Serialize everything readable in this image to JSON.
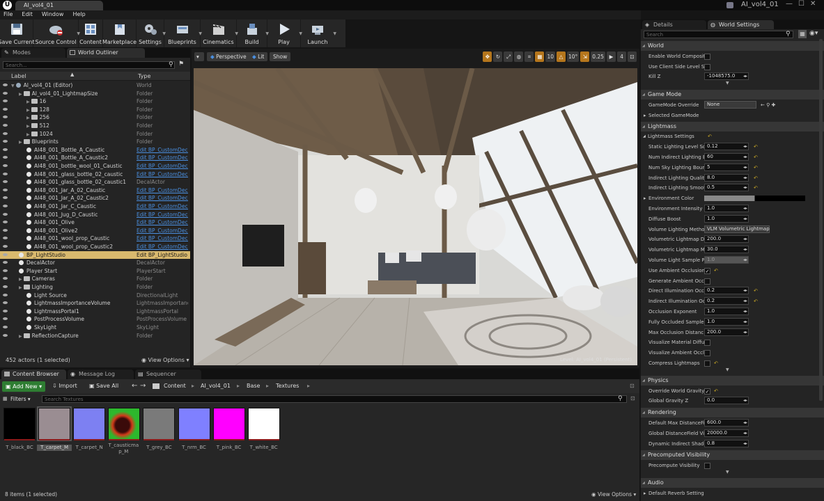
{
  "window": {
    "doc_tab": "AI_vol4_01",
    "project_name": "AI_vol4_01",
    "app_icon": "U"
  },
  "menu": [
    "File",
    "Edit",
    "Window",
    "Help"
  ],
  "toolbar": [
    {
      "label": "Save Current",
      "icon": "save-icon"
    },
    {
      "label": "Source Control",
      "icon": "source-control-icon"
    },
    {
      "label": "Content",
      "icon": "content-icon"
    },
    {
      "label": "Marketplace",
      "icon": "marketplace-icon"
    },
    {
      "label": "Settings",
      "icon": "settings-icon"
    },
    {
      "label": "Blueprints",
      "icon": "blueprints-icon"
    },
    {
      "label": "Cinematics",
      "icon": "cinematics-icon"
    },
    {
      "label": "Build",
      "icon": "build-icon"
    },
    {
      "label": "Play",
      "icon": "play-icon"
    },
    {
      "label": "Launch",
      "icon": "launch-icon"
    }
  ],
  "left_tabs": {
    "modes": "Modes",
    "outliner": "World Outliner"
  },
  "outliner": {
    "search_placeholder": "Search...",
    "col_label": "Label",
    "col_type": "Type",
    "rows": [
      {
        "label": "AI_vol4_01 (Editor)",
        "type": "World",
        "indent": 0,
        "icon": "world",
        "link": false
      },
      {
        "label": "AI_vol4_01_LightmapSize",
        "type": "Folder",
        "indent": 1,
        "icon": "folder",
        "link": false
      },
      {
        "label": "16",
        "type": "Folder",
        "indent": 2,
        "icon": "folder",
        "link": false
      },
      {
        "label": "128",
        "type": "Folder",
        "indent": 2,
        "icon": "folder",
        "link": false
      },
      {
        "label": "256",
        "type": "Folder",
        "indent": 2,
        "icon": "folder",
        "link": false
      },
      {
        "label": "512",
        "type": "Folder",
        "indent": 2,
        "icon": "folder",
        "link": false
      },
      {
        "label": "1024",
        "type": "Folder",
        "indent": 2,
        "icon": "folder",
        "link": false
      },
      {
        "label": "Blueprints",
        "type": "Folder",
        "indent": 1,
        "icon": "folder",
        "link": false
      },
      {
        "label": "AI48_001_Bottle_A_Caustic",
        "type": "Edit BP_CustomDeca",
        "indent": 2,
        "icon": "ball",
        "link": true
      },
      {
        "label": "AI48_001_Bottle_A_Caustic2",
        "type": "Edit BP_CustomDeca",
        "indent": 2,
        "icon": "ball",
        "link": true
      },
      {
        "label": "AI48_001_bottle_wool_01_Caustic",
        "type": "Edit BP_CustomDeca",
        "indent": 2,
        "icon": "ball",
        "link": true
      },
      {
        "label": "AI48_001_glass_bottle_02_caustic",
        "type": "Edit BP_CustomDeca",
        "indent": 2,
        "icon": "ball",
        "link": true
      },
      {
        "label": "AI48_001_glass_bottle_02_caustic1",
        "type": "DecalActor",
        "indent": 2,
        "icon": "ball",
        "link": false
      },
      {
        "label": "AI48_001_Jar_A_02_Caustic",
        "type": "Edit BP_CustomDeca",
        "indent": 2,
        "icon": "ball",
        "link": true
      },
      {
        "label": "AI48_001_Jar_A_02_Caustic2",
        "type": "Edit BP_CustomDeca",
        "indent": 2,
        "icon": "ball",
        "link": true
      },
      {
        "label": "AI48_001_Jar_C_Caustic",
        "type": "Edit BP_CustomDeca",
        "indent": 2,
        "icon": "ball",
        "link": true
      },
      {
        "label": "AI48_001_Jug_D_Caustic",
        "type": "Edit BP_CustomDeca",
        "indent": 2,
        "icon": "ball",
        "link": true
      },
      {
        "label": "AI48_001_Olive",
        "type": "Edit BP_CustomDeca",
        "indent": 2,
        "icon": "ball",
        "link": true
      },
      {
        "label": "AI48_001_Olive2",
        "type": "Edit BP_CustomDeca",
        "indent": 2,
        "icon": "ball",
        "link": true
      },
      {
        "label": "AI48_001_wool_prop_Caustic",
        "type": "Edit BP_CustomDeca",
        "indent": 2,
        "icon": "ball",
        "link": true
      },
      {
        "label": "AI48_001_wool_prop_Caustic2",
        "type": "Edit BP_CustomDeca",
        "indent": 2,
        "icon": "ball",
        "link": true
      },
      {
        "label": "BP_LightStudio",
        "type": "Edit BP_LightStudio",
        "indent": 1,
        "icon": "ball",
        "link": false,
        "selected": true
      },
      {
        "label": "DecalActor",
        "type": "DecalActor",
        "indent": 1,
        "icon": "ball",
        "link": false
      },
      {
        "label": "Player Start",
        "type": "PlayerStart",
        "indent": 1,
        "icon": "ball",
        "link": false
      },
      {
        "label": "Cameras",
        "type": "Folder",
        "indent": 1,
        "icon": "folder",
        "link": false
      },
      {
        "label": "Lighting",
        "type": "Folder",
        "indent": 1,
        "icon": "folder",
        "link": false
      },
      {
        "label": "Light Source",
        "type": "DirectionalLight",
        "indent": 2,
        "icon": "ball",
        "link": false
      },
      {
        "label": "LightmassImportanceVolume",
        "type": "LightmassImportance",
        "indent": 2,
        "icon": "ball",
        "link": false
      },
      {
        "label": "LightmassPortal1",
        "type": "LightmassPortal",
        "indent": 2,
        "icon": "ball",
        "link": false
      },
      {
        "label": "PostProcessVolume",
        "type": "PostProcessVolume",
        "indent": 2,
        "icon": "ball",
        "link": false
      },
      {
        "label": "SkyLight",
        "type": "SkyLight",
        "indent": 2,
        "icon": "ball",
        "link": false
      },
      {
        "label": "ReflectionCapture",
        "type": "Folder",
        "indent": 1,
        "icon": "folder",
        "link": false
      }
    ],
    "footer_count": "452 actors (1 selected)",
    "view_options": "View Options"
  },
  "viewport": {
    "perspective": "Perspective",
    "lit": "Lit",
    "show": "Show",
    "grid_snap": "10",
    "rot_snap": "10°",
    "scale_snap": "0.25",
    "cam_speed": "4",
    "level_label": "Level:  AI_vol4_01 (Persistent)"
  },
  "content_browser": {
    "tabs": [
      "Content Browser",
      "Message Log",
      "Sequencer"
    ],
    "add_new": "Add New",
    "import": "Import",
    "save_all": "Save All",
    "path": [
      "Content",
      "AI_vol4_01",
      "Base",
      "Textures"
    ],
    "filters": "Filters",
    "search_placeholder": "Search Textures",
    "items": [
      {
        "name": "T_black_BC",
        "color": "#000000"
      },
      {
        "name": "T_carpet_M",
        "color": "#9a8d92"
      },
      {
        "name": "T_carpet_N",
        "color": "#7d80f2"
      },
      {
        "name": "T_causticmap_M",
        "color": "#2db82d"
      },
      {
        "name": "T_grey_BC",
        "color": "#7a7a7a"
      },
      {
        "name": "T_nrm_BC",
        "color": "#7f80ff"
      },
      {
        "name": "T_pink_BC",
        "color": "#ff00ff"
      },
      {
        "name": "T_white_BC",
        "color": "#ffffff"
      }
    ],
    "footer_count": "8 items (1 selected)",
    "view_options": "View Options"
  },
  "details": {
    "tabs": [
      "Details",
      "World Settings"
    ],
    "search_placeholder": "Search",
    "sections": {
      "world": "World",
      "game_mode": "Game Mode",
      "lightmass": "Lightmass",
      "physics": "Physics",
      "rendering": "Rendering",
      "precomputed": "Precomputed Visibility",
      "audio": "Audio"
    },
    "world_rows": [
      {
        "label": "Enable World Compositio",
        "kind": "check",
        "value": ""
      },
      {
        "label": "Use Client Side Level Stre",
        "kind": "check",
        "value": ""
      },
      {
        "label": "Kill Z",
        "kind": "num",
        "value": "-1048575.0"
      }
    ],
    "gamemode_rows": [
      {
        "label": "GameMode Override",
        "kind": "dropdown",
        "value": "None"
      },
      {
        "label": "Selected GameMode",
        "kind": "sub",
        "value": ""
      }
    ],
    "lightmass_settings": "Lightmass Settings",
    "lightmass_rows": [
      {
        "label": "Static Lighting Level Sc",
        "kind": "num",
        "value": "0.12",
        "reset": true
      },
      {
        "label": "Num Indirect Lighting B",
        "kind": "num",
        "value": "60",
        "reset": true
      },
      {
        "label": "Num Sky Lighting Boun",
        "kind": "num",
        "value": "5",
        "reset": true
      },
      {
        "label": "Indirect Lighting Qualit",
        "kind": "num",
        "value": "8.0",
        "reset": true
      },
      {
        "label": "Indirect Lighting Smoot",
        "kind": "num",
        "value": "0.5",
        "reset": true
      },
      {
        "label": "Environment Color",
        "kind": "color",
        "value": ""
      },
      {
        "label": "Environment Intensity",
        "kind": "num",
        "value": "1.0"
      },
      {
        "label": "Diffuse Boost",
        "kind": "num",
        "value": "1.0"
      },
      {
        "label": "Volume Lighting Metho",
        "kind": "dropdown",
        "value": "VLM Volumetric Lightmap"
      },
      {
        "label": "Volumetric Lightmap D",
        "kind": "num",
        "value": "200.0"
      },
      {
        "label": "Volumetric Lightmap M",
        "kind": "num",
        "value": "30.0"
      },
      {
        "label": "Volume Light Sample P",
        "kind": "numdim",
        "value": "1.0"
      },
      {
        "label": "Use Ambient Occlusion",
        "kind": "checked",
        "value": "",
        "reset": true
      },
      {
        "label": "Generate Ambient Occl",
        "kind": "check",
        "value": ""
      },
      {
        "label": "Direct Illumination Occ",
        "kind": "num",
        "value": "0.2",
        "reset": true
      },
      {
        "label": "Indirect Illumination Oc",
        "kind": "num",
        "value": "0.2",
        "reset": true
      },
      {
        "label": "Occlusion Exponent",
        "kind": "num",
        "value": "1.0"
      },
      {
        "label": "Fully Occluded Sample",
        "kind": "num",
        "value": "1.0"
      },
      {
        "label": "Max Occlusion Distanc",
        "kind": "num",
        "value": "200.0"
      },
      {
        "label": "Visualize Material Diffu",
        "kind": "check",
        "value": ""
      },
      {
        "label": "Visualize Ambient Occl",
        "kind": "check",
        "value": ""
      },
      {
        "label": "Compress Lightmaps",
        "kind": "check",
        "value": "",
        "reset": true
      }
    ],
    "physics_rows": [
      {
        "label": "Override World Gravity",
        "kind": "checked",
        "value": "",
        "reset": true
      },
      {
        "label": "Global Gravity Z",
        "kind": "num",
        "value": "0.0"
      }
    ],
    "rendering_rows": [
      {
        "label": "Default Max DistanceFiel",
        "kind": "num",
        "value": "600.0"
      },
      {
        "label": "Global DistanceField View",
        "kind": "num",
        "value": "20000.0"
      },
      {
        "label": "Dynamic Indirect Shadow",
        "kind": "num",
        "value": "0.8"
      }
    ],
    "precomputed_rows": [
      {
        "label": "Precompute Visibility",
        "kind": "check",
        "value": ""
      }
    ],
    "audio_rows": [
      {
        "label": "Default Reverb Settings",
        "kind": "sub",
        "value": ""
      }
    ]
  }
}
